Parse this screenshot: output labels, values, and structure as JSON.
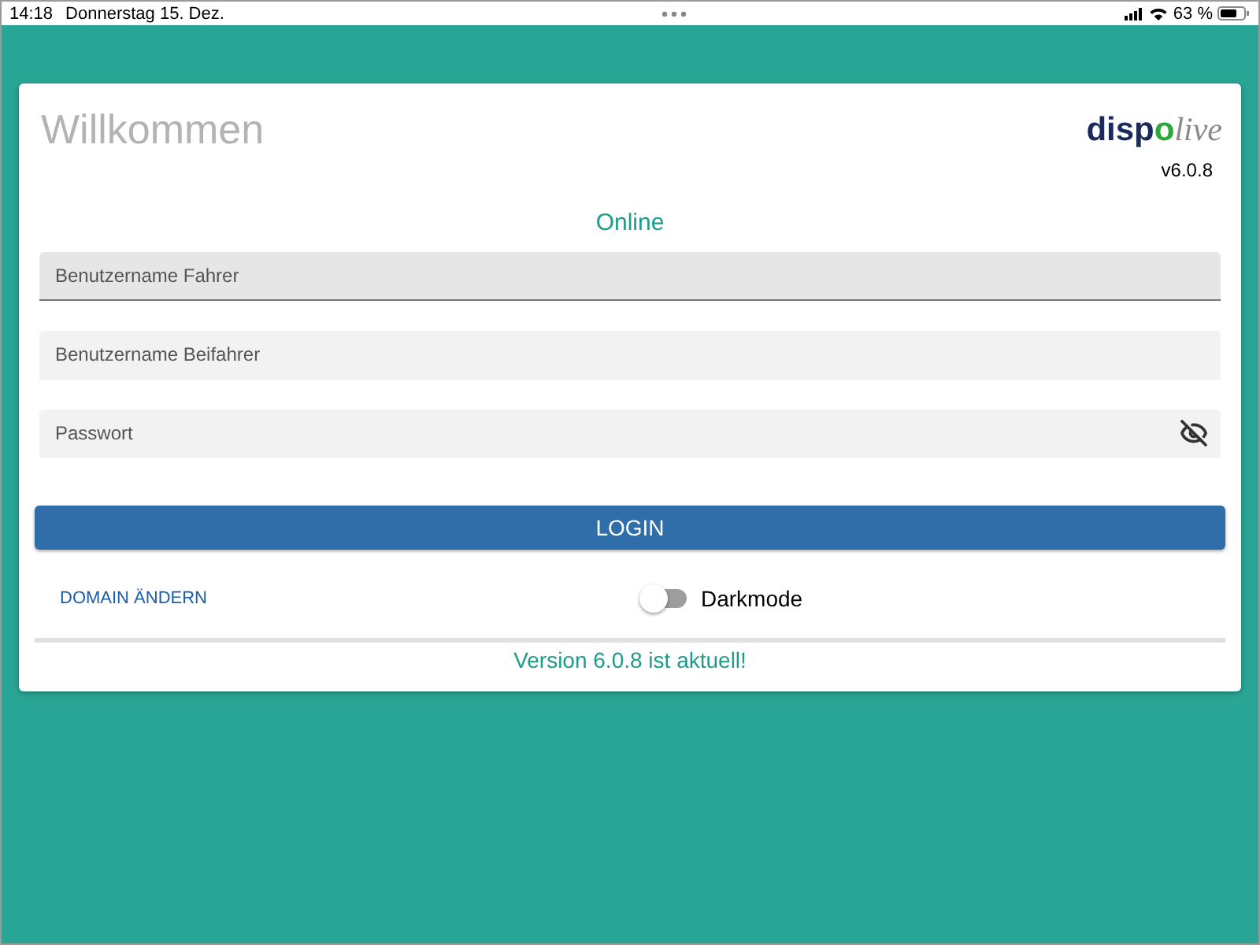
{
  "status_bar": {
    "time": "14:18",
    "date": "Donnerstag 15. Dez.",
    "battery": "63 %"
  },
  "card": {
    "title": "Willkommen",
    "logo": [
      {
        "text": "disp",
        "kind": "bold"
      },
      {
        "text": "o",
        "kind": "accent"
      },
      {
        "text": "live",
        "kind": "italic"
      }
    ],
    "version": "v6.0.8",
    "status": "Online",
    "fields": [
      {
        "placeholder": "Benutzername Fahrer",
        "focused": true,
        "kind": "text"
      },
      {
        "placeholder": "Benutzername Beifahrer",
        "focused": false,
        "kind": "text"
      },
      {
        "placeholder": "Passwort",
        "focused": false,
        "kind": "password"
      }
    ],
    "login_button": "LOGIN",
    "domain_link": "DOMAIN ÄNDERN",
    "darkmode": {
      "label": "Darkmode",
      "on": false
    },
    "update_message": "Version 6.0.8 ist aktuell!"
  }
}
